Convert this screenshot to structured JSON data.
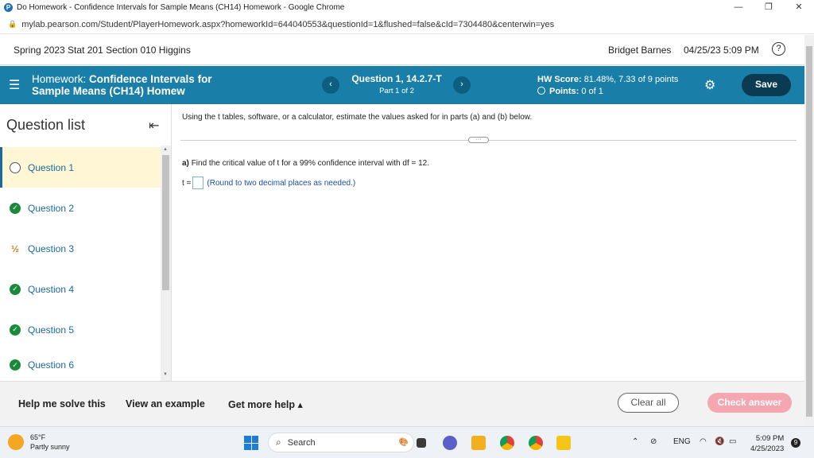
{
  "window": {
    "title": "Do Homework - Confidence Intervals for Sample Means (CH14) Homework - Google Chrome",
    "url": "mylab.pearson.com/Student/PlayerHomework.aspx?homeworkId=644040553&questionId=1&flushed=false&cId=7304480&centerwin=yes"
  },
  "header": {
    "course": "Spring 2023 Stat 201 Section 010 Higgins",
    "user": "Bridget Barnes",
    "datetime": "04/25/23 5:09 PM"
  },
  "homework": {
    "label": "Homework:",
    "title_line1": "Confidence Intervals for",
    "title_line2": "Sample Means (CH14) Homew",
    "question": "Question 1, 14.2.7-T",
    "part": "Part 1 of 2",
    "hw_score_label": "HW Score:",
    "hw_score_value": "81.48%, 7.33 of 9 points",
    "points_label": "Points:",
    "points_value": "0 of 1",
    "save_label": "Save",
    "prev_glyph": "‹",
    "next_glyph": "›"
  },
  "question_list": {
    "title": "Question list",
    "items": [
      {
        "label": "Question 1",
        "status": "current"
      },
      {
        "label": "Question 2",
        "status": "done"
      },
      {
        "label": "Question 3",
        "status": "partial"
      },
      {
        "label": "Question 4",
        "status": "done"
      },
      {
        "label": "Question 5",
        "status": "done"
      },
      {
        "label": "Question 6",
        "status": "done"
      }
    ]
  },
  "content": {
    "instructions": "Using the t tables, software, or a calculator, estimate the values asked for in parts (a) and (b) below.",
    "part_a_label": "a)",
    "part_a_text": "Find the critical value of t for a 99% confidence interval with df = 12.",
    "answer_prefix": "t =",
    "answer_value": "",
    "answer_hint": "(Round to two decimal places as needed.)",
    "divider_handle": "···"
  },
  "footer": {
    "help_solve": "Help me solve this",
    "view_example": "View an example",
    "get_more_help": "Get more help ▴",
    "clear_all": "Clear all",
    "check_answer": "Check answer"
  },
  "taskbar": {
    "temp": "65°F",
    "weather": "Partly sunny",
    "search": "Search",
    "language": "ENG",
    "time": "5:09 PM",
    "date": "4/25/2023",
    "notifications": "9"
  }
}
